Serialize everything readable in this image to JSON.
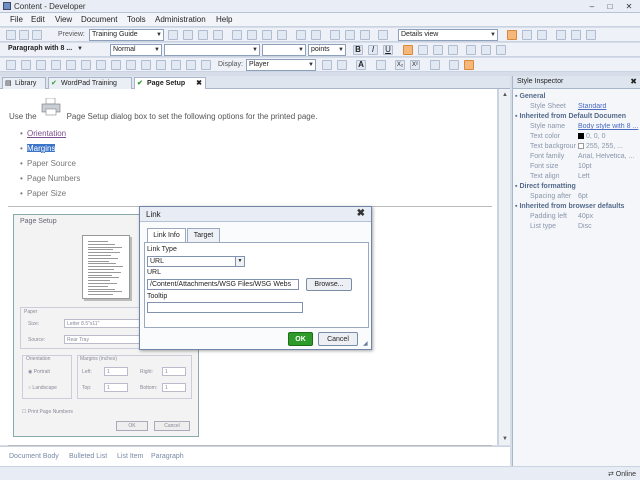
{
  "window": {
    "title": "Content - Developer",
    "min": "–",
    "max": "□",
    "close": "✕"
  },
  "menu": [
    "File",
    "Edit",
    "View",
    "Document",
    "Tools",
    "Administration",
    "Help"
  ],
  "toolbar1": {
    "preview_label": "Preview:",
    "preview_value": "Training Guide",
    "view_value": "Details view"
  },
  "toolbar2": {
    "style_value": "Paragraph with 8 ...",
    "font_value": "Normal",
    "size_value": "",
    "unit_value": "points",
    "bold": "B",
    "italic": "I",
    "underline": "U"
  },
  "toolbar3": {
    "display_label": "Display:",
    "display_value": "Player",
    "font_a": "A",
    "sub": "X₂",
    "sup": "X²"
  },
  "tabs": [
    {
      "label": "Library",
      "icon": "library-icon"
    },
    {
      "label": "WordPad Training",
      "icon": "check-icon"
    },
    {
      "label": "Page Setup",
      "icon": "check-icon",
      "close": "✖"
    }
  ],
  "content": {
    "intro_left": "Use the",
    "intro_right": "Page Setup dialog box to set the following options for the printed page.",
    "bullets": [
      "Orientation",
      "Margins",
      "Paper Source",
      "Page Numbers",
      "Paper Size"
    ]
  },
  "page_setup_image": {
    "title": "Page Setup",
    "paper": "Paper",
    "size_label": "Size:",
    "size_value": "Letter 8.5\"x11\"",
    "source_label": "Source:",
    "source_value": "Rear Tray",
    "orientation": "Orientation",
    "portrait": "Portrait",
    "landscape": "Landscape",
    "margins": "Margins (inches)",
    "left": "Left:",
    "right": "Right:",
    "top": "Top:",
    "bottom": "Bottom:",
    "m_left": "1",
    "m_right": "1",
    "m_top": "1",
    "m_bottom": "1",
    "print_page_numbers": "Print Page Numbers",
    "ok": "OK",
    "cancel": "Cancel"
  },
  "link_dialog": {
    "title": "Link",
    "close": "✖",
    "tab_link_info": "Link Info",
    "tab_target": "Target",
    "link_type_label": "Link Type",
    "link_type_value": "URL",
    "url_label": "URL",
    "url_value": "/Content/Attachments/WSG Files/WSG Webs",
    "browse": "Browse...",
    "tooltip_label": "Tooltip",
    "tooltip_value": "",
    "ok": "OK",
    "cancel": "Cancel"
  },
  "breadcrumbs": [
    "Document Body",
    "Bulleted List",
    "List Item",
    "Paragraph"
  ],
  "inspector": {
    "title": "Style Inspector",
    "close": "✖",
    "general": "General",
    "style_sheet_k": "Style Sheet",
    "style_sheet_v": "Standard",
    "inherited_default": "Inherited from Default Documen",
    "rows": [
      {
        "k": "Style name",
        "v": "Body style with 8 ..."
      },
      {
        "k": "Text color",
        "v": "0, 0, 0"
      },
      {
        "k": "Text backgrour",
        "v": "255, 255, ..."
      },
      {
        "k": "Font family",
        "v": "Arial, Helvetica, ..."
      },
      {
        "k": "Font size",
        "v": "10pt"
      },
      {
        "k": "Text align",
        "v": "Left"
      }
    ],
    "direct": "Direct formatting",
    "spacing_k": "Spacing after",
    "spacing_v": "6pt",
    "inherited_browser": "Inherited from browser defaults",
    "padding_k": "Padding left",
    "padding_v": "40px",
    "list_k": "List type",
    "list_v": "Disc"
  },
  "status": {
    "online": "Online"
  },
  "colors": {
    "accent": "#2e9a2a",
    "link": "#4a6bc0",
    "highlight": "#f5b87a"
  }
}
